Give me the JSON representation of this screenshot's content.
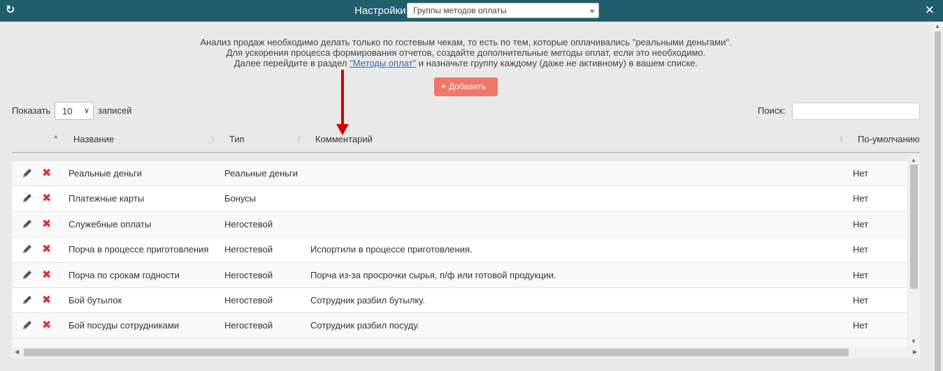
{
  "header": {
    "title": "Настройки",
    "select_value": "Группы методов оплаты",
    "refresh_icon": "refresh-icon",
    "close_icon": "close-icon"
  },
  "info": {
    "line1": "Анализ продаж необходимо делать только по гостевым чекам, то есть по тем, которые оплачивались \"реальными деньгами\".",
    "line2": "Для ускорения процесса формирования отчетов, создайте дополнительные методы оплат, если это необходимо.",
    "line3_before": "Далее перейдите в раздел ",
    "line3_link": "\"Методы оплат\"",
    "line3_after": " и назначьте группу каждому (даже не активному) в вашем списке."
  },
  "add_button": "Добавить",
  "controls": {
    "show_label": "Показать",
    "length_value": "10",
    "records_label": "записей",
    "search_label": "Поиск:",
    "search_value": ""
  },
  "table": {
    "columns": [
      "Название",
      "Тип",
      "Комментарий",
      "По-умолчанию"
    ],
    "rows": [
      {
        "name": "Реальные деньги",
        "type": "Реальные деньги",
        "comment": "",
        "default": "Нет"
      },
      {
        "name": "Платежные карты",
        "type": "Бонусы",
        "comment": "",
        "default": "Нет"
      },
      {
        "name": "Служебные оплаты",
        "type": "Негостевой",
        "comment": "",
        "default": "Нет"
      },
      {
        "name": "Порча в процессе приготовления",
        "type": "Негостевой",
        "comment": "Испортили в процессе приготовления.",
        "default": "Нет"
      },
      {
        "name": "Порча по срокам годности",
        "type": "Негостевой",
        "comment": "Порча из-за просрочки сырья, п/ф или готовой продукции.",
        "default": "Нет"
      },
      {
        "name": "Бой бутылок",
        "type": "Негостевой",
        "comment": "Сотрудник разбил бутылку.",
        "default": "Нет"
      },
      {
        "name": "Бой посуды сотрудниками",
        "type": "Негостевой",
        "comment": "Сотрудник разбил посуду.",
        "default": "Нет"
      }
    ]
  },
  "colors": {
    "header_bg": "#215e6d",
    "add_button_bg": "#f0776a",
    "delete_icon": "#e03030",
    "annotation_arrow": "#d00000"
  }
}
